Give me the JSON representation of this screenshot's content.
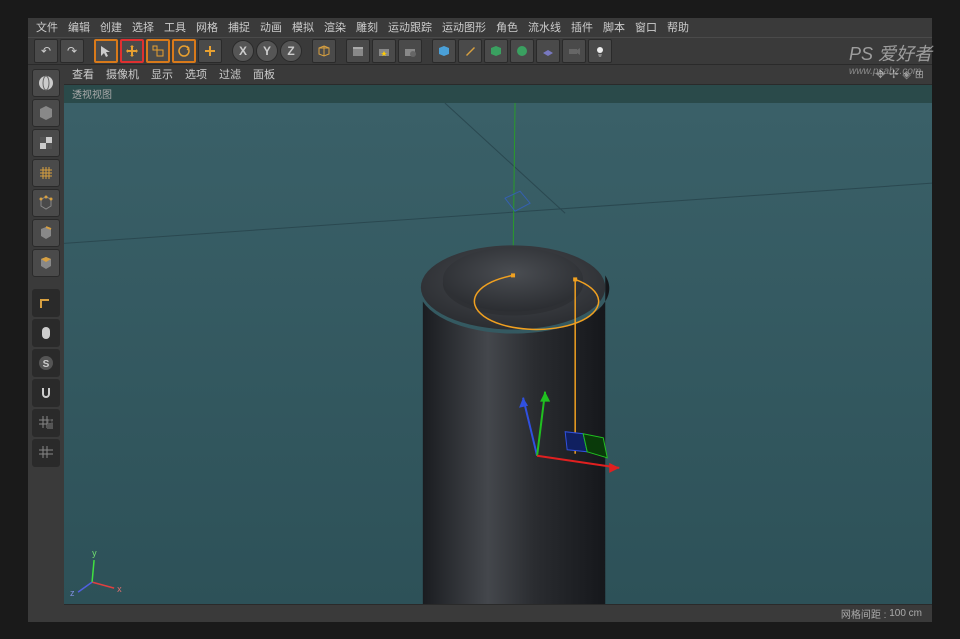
{
  "menu": {
    "file": "文件",
    "edit": "编辑",
    "create": "创建",
    "select": "选择",
    "tool": "工具",
    "mesh": "网格",
    "snap": "捕捉",
    "anim": "动画",
    "sim": "模拟",
    "render": "渲染",
    "sculpt": "雕刻",
    "motrack": "运动跟踪",
    "mograph": "运动图形",
    "char": "角色",
    "pipeline": "流水线",
    "plugin": "插件",
    "script": "脚本",
    "window": "窗口",
    "help": "帮助"
  },
  "toolbar": {
    "undo": "↶",
    "redo": "↷",
    "x": "X",
    "y": "Y",
    "z": "Z"
  },
  "vp_header": {
    "view": "查看",
    "camera": "摄像机",
    "display": "显示",
    "options": "选项",
    "filter": "过滤",
    "panel": "面板"
  },
  "vp_title": "透视视图",
  "status": {
    "grid_label": "网格间距 :",
    "grid_value": "100 cm"
  },
  "world_axis": {
    "x": "x",
    "y": "y",
    "z": "z"
  },
  "watermark": {
    "main": "PS 爱好者",
    "sub": "www.psahz.com"
  }
}
